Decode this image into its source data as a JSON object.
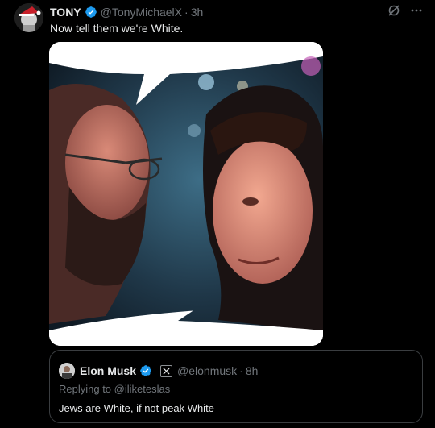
{
  "tweet": {
    "author_name": "TONY",
    "handle": "@TonyMichaelX",
    "separator": "·",
    "time": "3h",
    "text": "Now tell them we're White."
  },
  "quote": {
    "author_name": "Elon Musk",
    "handle": "@elonmusk",
    "separator": "·",
    "time": "8h",
    "replying_to": "Replying to @iliketeslas",
    "text": "Jews are White, if not peak White"
  },
  "icons": {
    "verified": "verified-badge-icon",
    "grok": "grok-icon",
    "more": "more-options-icon",
    "x_logo": "x-logo-icon"
  },
  "colors": {
    "background": "#000000",
    "text": "#e7e9ea",
    "muted": "#71767b",
    "verified": "#1d9bf0",
    "border": "#3a3d40"
  }
}
